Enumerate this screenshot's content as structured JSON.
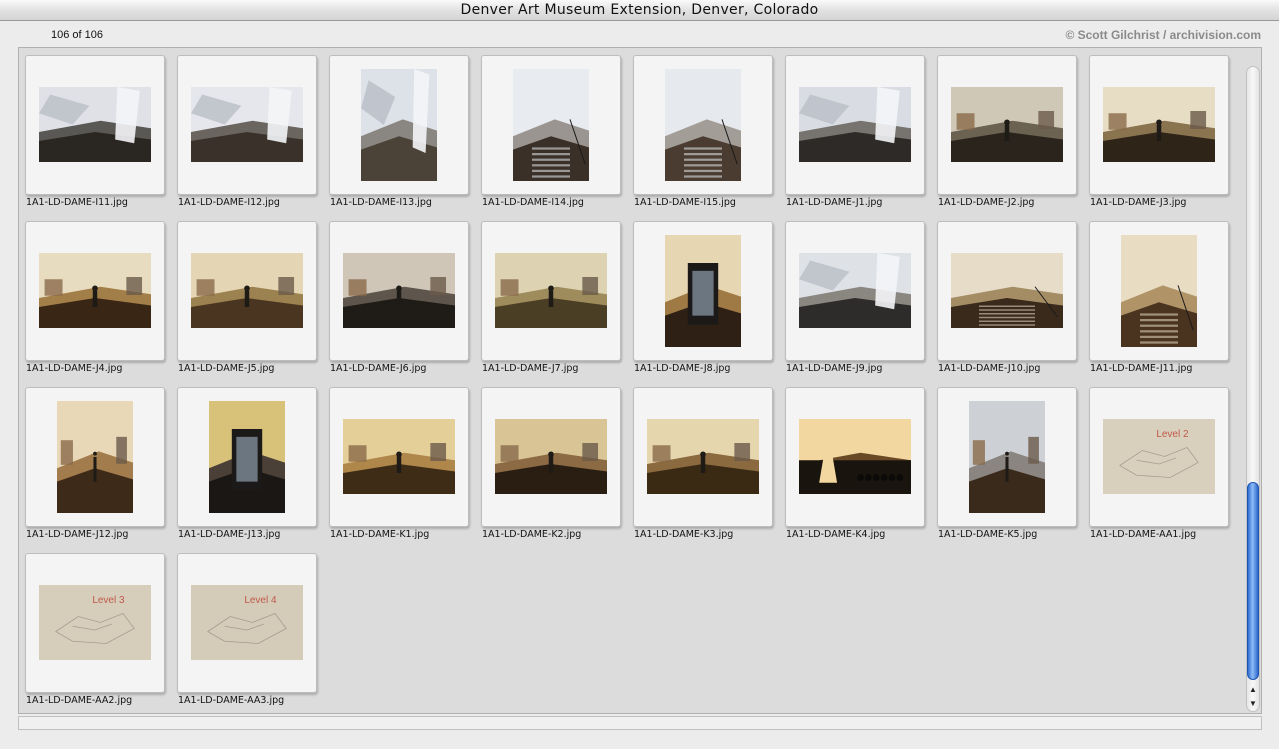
{
  "window": {
    "title": "Denver Art Museum Extension, Denver, Colorado"
  },
  "toolbar": {
    "count": "106 of 106",
    "credit": "© Scott Gilchrist / archivision.com"
  },
  "gallery": {
    "items": [
      {
        "file": "1A1-LD-DAME-I11.jpg",
        "orient": "land",
        "scene": "atrium",
        "colors": [
          "#dfe1e6",
          "#5a5854",
          "#2a2622"
        ]
      },
      {
        "file": "1A1-LD-DAME-I12.jpg",
        "orient": "land",
        "scene": "atrium",
        "colors": [
          "#e5e7ec",
          "#6b6560",
          "#3a322a"
        ]
      },
      {
        "file": "1A1-LD-DAME-I13.jpg",
        "orient": "port",
        "scene": "atrium",
        "colors": [
          "#dde1e8",
          "#8a8782",
          "#4b4238"
        ]
      },
      {
        "file": "1A1-LD-DAME-I14.jpg",
        "orient": "port",
        "scene": "stairs",
        "colors": [
          "#e8ebf0",
          "#9a9590",
          "#3a3028"
        ]
      },
      {
        "file": "1A1-LD-DAME-I15.jpg",
        "orient": "port",
        "scene": "stairs",
        "colors": [
          "#e6e9ee",
          "#a29d96",
          "#4a3c30"
        ]
      },
      {
        "file": "1A1-LD-DAME-J1.jpg",
        "orient": "land",
        "scene": "lobby",
        "colors": [
          "#d9dde3",
          "#77736e",
          "#2e2a27"
        ]
      },
      {
        "file": "1A1-LD-DAME-J2.jpg",
        "orient": "land",
        "scene": "gallery",
        "colors": [
          "#cfc8b6",
          "#6b6252",
          "#2a241d"
        ]
      },
      {
        "file": "1A1-LD-DAME-J3.jpg",
        "orient": "land",
        "scene": "gallery",
        "colors": [
          "#e7dcc4",
          "#8a7450",
          "#2e2418"
        ]
      },
      {
        "file": "1A1-LD-DAME-J4.jpg",
        "orient": "land",
        "scene": "gallery",
        "colors": [
          "#e8dcc0",
          "#a27e48",
          "#3a2614"
        ]
      },
      {
        "file": "1A1-LD-DAME-J5.jpg",
        "orient": "land",
        "scene": "gallery",
        "colors": [
          "#e4d6b4",
          "#9c8250",
          "#4a3620"
        ]
      },
      {
        "file": "1A1-LD-DAME-J6.jpg",
        "orient": "land",
        "scene": "gallery",
        "colors": [
          "#cfc6b8",
          "#5e564c",
          "#1f1b17"
        ]
      },
      {
        "file": "1A1-LD-DAME-J7.jpg",
        "orient": "land",
        "scene": "gallery",
        "colors": [
          "#ddd3b2",
          "#9e8c5c",
          "#4a3e24"
        ]
      },
      {
        "file": "1A1-LD-DAME-J8.jpg",
        "orient": "port",
        "scene": "doorway",
        "colors": [
          "#e6d6b2",
          "#a07a44",
          "#2e2014"
        ]
      },
      {
        "file": "1A1-LD-DAME-J9.jpg",
        "orient": "land",
        "scene": "lobby",
        "colors": [
          "#dee1e6",
          "#8a8680",
          "#2e2c2a"
        ]
      },
      {
        "file": "1A1-LD-DAME-J10.jpg",
        "orient": "land",
        "scene": "stairs",
        "colors": [
          "#e6dcc8",
          "#a48c64",
          "#3a2a1c"
        ]
      },
      {
        "file": "1A1-LD-DAME-J11.jpg",
        "orient": "port",
        "scene": "stairs",
        "colors": [
          "#e8dcc2",
          "#b09468",
          "#4a3420"
        ]
      },
      {
        "file": "1A1-LD-DAME-J12.jpg",
        "orient": "port",
        "scene": "gallery",
        "colors": [
          "#e8d8b8",
          "#a27c4c",
          "#3e2a18"
        ]
      },
      {
        "file": "1A1-LD-DAME-J13.jpg",
        "orient": "port",
        "scene": "doorway",
        "colors": [
          "#d8c27a",
          "#4a4038",
          "#1a1714"
        ]
      },
      {
        "file": "1A1-LD-DAME-K1.jpg",
        "orient": "land",
        "scene": "gallery",
        "colors": [
          "#e4cf98",
          "#b0874a",
          "#3e2c16"
        ]
      },
      {
        "file": "1A1-LD-DAME-K2.jpg",
        "orient": "land",
        "scene": "gallery",
        "colors": [
          "#d8c494",
          "#8c6a44",
          "#2a1e12"
        ]
      },
      {
        "file": "1A1-LD-DAME-K3.jpg",
        "orient": "land",
        "scene": "gallery",
        "colors": [
          "#e6d6ae",
          "#8a6a3e",
          "#3a2a14"
        ]
      },
      {
        "file": "1A1-LD-DAME-K4.jpg",
        "orient": "land",
        "scene": "dark",
        "colors": [
          "#f2d8a0",
          "#6a4a26",
          "#14100c"
        ]
      },
      {
        "file": "1A1-LD-DAME-K5.jpg",
        "orient": "port",
        "scene": "gallery",
        "colors": [
          "#cdd1d6",
          "#8a8580",
          "#3a2a1c"
        ]
      },
      {
        "file": "1A1-LD-DAME-AA1.jpg",
        "orient": "land",
        "scene": "plan",
        "colors": [
          "#d8d0bc",
          "#a8a090",
          "#c0584a"
        ]
      },
      {
        "file": "1A1-LD-DAME-AA2.jpg",
        "orient": "land",
        "scene": "plan",
        "colors": [
          "#d6ceba",
          "#a69e8e",
          "#c0584a"
        ]
      },
      {
        "file": "1A1-LD-DAME-AA3.jpg",
        "orient": "land",
        "scene": "plan",
        "colors": [
          "#d4ccb8",
          "#a49c8c",
          "#c0584a"
        ]
      }
    ],
    "plan_labels": {
      "23": "Level 2",
      "24": "Level 3",
      "25": "Level 4"
    }
  }
}
